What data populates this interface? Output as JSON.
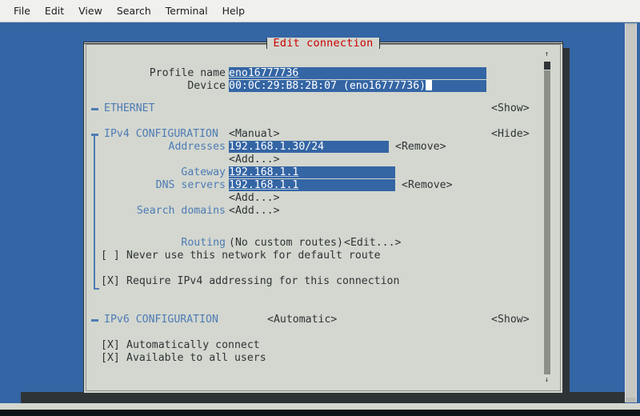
{
  "menu": {
    "items": [
      {
        "label": "File"
      },
      {
        "label": "Edit"
      },
      {
        "label": "View"
      },
      {
        "label": "Search"
      },
      {
        "label": "Terminal"
      },
      {
        "label": "Help"
      }
    ]
  },
  "dialog": {
    "title": "Edit connection",
    "title_color": "#cc0000",
    "background": "#d3d7cf",
    "field_color": "#3465a4",
    "label_color": "#4e7bb5",
    "profile": {
      "label": "Profile name",
      "value": "eno16777736"
    },
    "device": {
      "label": "Device",
      "value": "00:0C:29:B8:2B:07 (eno16777736)",
      "cursor": "block"
    },
    "ethernet": {
      "marker": "collapsed-icon",
      "label": "ETHERNET",
      "toggle": "<Show>"
    },
    "ipv4": {
      "marker": "expanded-icon",
      "label": "IPv4 CONFIGURATION",
      "method": "<Manual>",
      "toggle": "<Hide>",
      "addresses": {
        "label": "Addresses",
        "value": "192.168.1.30/24",
        "remove": "<Remove>",
        "add": "<Add...>"
      },
      "gateway": {
        "label": "Gateway",
        "value": "192.168.1.1"
      },
      "dns": {
        "label": "DNS servers",
        "value": "192.168.1.1",
        "remove": "<Remove>",
        "add": "<Add...>"
      },
      "search_domains": {
        "label": "Search domains",
        "add": "<Add...>"
      },
      "routing": {
        "label": "Routing",
        "value": "(No custom routes)",
        "edit": "<Edit...>"
      },
      "never_default": {
        "checkbox": "[ ]",
        "checked": false,
        "label": "Never use this network for default route"
      },
      "require_ipv4": {
        "checkbox": "[X]",
        "checked": true,
        "label": "Require IPv4 addressing for this connection"
      }
    },
    "ipv6": {
      "marker": "collapsed-icon",
      "label": "IPv6 CONFIGURATION",
      "method": "<Automatic>",
      "toggle": "<Show>"
    },
    "options": [
      {
        "checkbox": "[X]",
        "checked": true,
        "label": "Automatically connect"
      },
      {
        "checkbox": "[X]",
        "checked": true,
        "label": "Available to all users"
      }
    ],
    "scrollbar": {
      "up_arrow": "↑",
      "down_arrow": "↓"
    }
  }
}
